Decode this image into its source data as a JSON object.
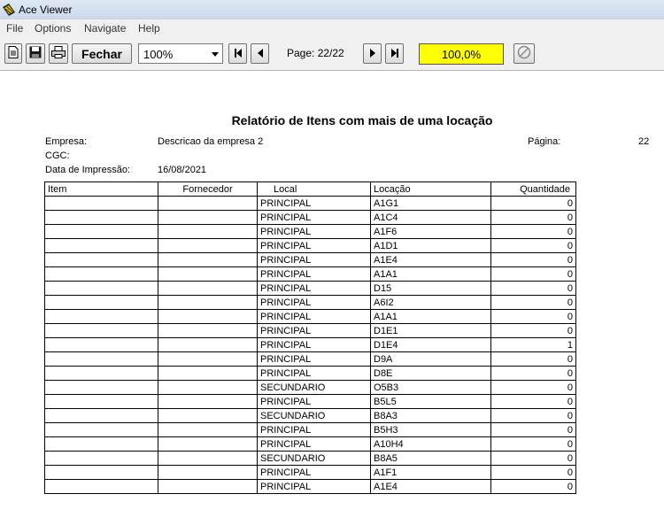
{
  "window": {
    "title": "Ace Viewer"
  },
  "menu": {
    "items": [
      "File",
      "Options",
      "Navigate",
      "Help"
    ]
  },
  "toolbar": {
    "close_label": "Fechar",
    "zoom_value": "100%",
    "page_label": "Page: 22/22",
    "progress_value": "100,0%",
    "progress_color": "#ffff00"
  },
  "report": {
    "title": "Relatório de Itens com mais de uma locação",
    "empresa_label": "Empresa:",
    "empresa_value": "Descricao da empresa 2",
    "pagina_label": "Página:",
    "pagina_value": "22",
    "cgc_label": "CGC:",
    "data_label": "Data de Impressão:",
    "data_value": "16/08/2021",
    "columns": [
      "Item",
      "Fornecedor",
      "Local",
      "Locação",
      "Quantidade"
    ],
    "rows": [
      {
        "item": "",
        "fornecedor": "",
        "local": "PRINCIPAL",
        "locacao": "A1G1",
        "quantidade": "0"
      },
      {
        "item": "",
        "fornecedor": "",
        "local": "PRINCIPAL",
        "locacao": "A1C4",
        "quantidade": "0"
      },
      {
        "item": "",
        "fornecedor": "",
        "local": "PRINCIPAL",
        "locacao": "A1F6",
        "quantidade": "0"
      },
      {
        "item": "",
        "fornecedor": "",
        "local": "PRINCIPAL",
        "locacao": "A1D1",
        "quantidade": "0"
      },
      {
        "item": "",
        "fornecedor": "",
        "local": "PRINCIPAL",
        "locacao": "A1E4",
        "quantidade": "0"
      },
      {
        "item": "",
        "fornecedor": "",
        "local": "PRINCIPAL",
        "locacao": "A1A1",
        "quantidade": "0"
      },
      {
        "item": "",
        "fornecedor": "",
        "local": "PRINCIPAL",
        "locacao": "D15",
        "quantidade": "0"
      },
      {
        "item": "",
        "fornecedor": "",
        "local": "PRINCIPAL",
        "locacao": "A6I2",
        "quantidade": "0"
      },
      {
        "item": "",
        "fornecedor": "",
        "local": "PRINCIPAL",
        "locacao": "A1A1",
        "quantidade": "0"
      },
      {
        "item": "",
        "fornecedor": "",
        "local": "PRINCIPAL",
        "locacao": "D1E1",
        "quantidade": "0"
      },
      {
        "item": "",
        "fornecedor": "",
        "local": "PRINCIPAL",
        "locacao": "D1E4",
        "quantidade": "1"
      },
      {
        "item": "",
        "fornecedor": "",
        "local": "PRINCIPAL",
        "locacao": "D9A",
        "quantidade": "0"
      },
      {
        "item": "",
        "fornecedor": "",
        "local": "PRINCIPAL",
        "locacao": "D8E",
        "quantidade": "0"
      },
      {
        "item": "",
        "fornecedor": "",
        "local": "SECUNDARIO",
        "locacao": "O5B3",
        "quantidade": "0"
      },
      {
        "item": "",
        "fornecedor": "",
        "local": "PRINCIPAL",
        "locacao": "B5L5",
        "quantidade": "0"
      },
      {
        "item": "",
        "fornecedor": "",
        "local": "SECUNDARIO",
        "locacao": "B8A3",
        "quantidade": "0"
      },
      {
        "item": "",
        "fornecedor": "",
        "local": "PRINCIPAL",
        "locacao": "B5H3",
        "quantidade": "0"
      },
      {
        "item": "",
        "fornecedor": "",
        "local": "PRINCIPAL",
        "locacao": "A10H4",
        "quantidade": "0"
      },
      {
        "item": "",
        "fornecedor": "",
        "local": "SECUNDARIO",
        "locacao": "B8A5",
        "quantidade": "0"
      },
      {
        "item": "",
        "fornecedor": "",
        "local": "PRINCIPAL",
        "locacao": "A1F1",
        "quantidade": "0"
      },
      {
        "item": "",
        "fornecedor": "",
        "local": "PRINCIPAL",
        "locacao": "A1E4",
        "quantidade": "0"
      }
    ]
  }
}
